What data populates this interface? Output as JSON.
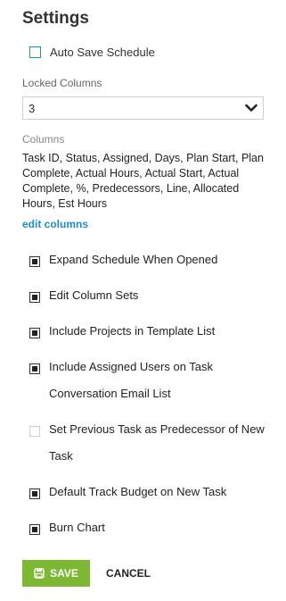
{
  "settings": {
    "title": "Settings",
    "auto_save": {
      "label": "Auto Save Schedule",
      "checked": false
    },
    "locked_columns": {
      "label": "Locked Columns",
      "value": "3"
    },
    "columns": {
      "label": "Columns",
      "list": "Task ID, Status, Assigned, Days, Plan Start, Plan Complete, Actual Hours, Actual Start, Actual Complete, %, Predecessors, Line, Allocated Hours, Est Hours",
      "edit_link": "edit columns"
    },
    "options": [
      {
        "label": "Expand Schedule When Opened",
        "checked": true
      },
      {
        "label": "Edit Column Sets",
        "checked": true
      },
      {
        "label": "Include Projects in Template List",
        "checked": true
      },
      {
        "label": "Include Assigned Users on Task Conversation Email List",
        "checked": true
      },
      {
        "label": "Set Previous Task as Predecessor of New Task",
        "checked": false
      },
      {
        "label": "Default Track Budget on New Task",
        "checked": true
      },
      {
        "label": "Burn Chart",
        "checked": true
      }
    ],
    "actions": {
      "save_label": "SAVE",
      "cancel_label": "CANCEL"
    }
  },
  "colors": {
    "accent": "#1a8fc8",
    "save_bg": "#7cb832"
  },
  "icons": {
    "select_arrow": "chevron-down-icon",
    "save": "save-icon"
  }
}
